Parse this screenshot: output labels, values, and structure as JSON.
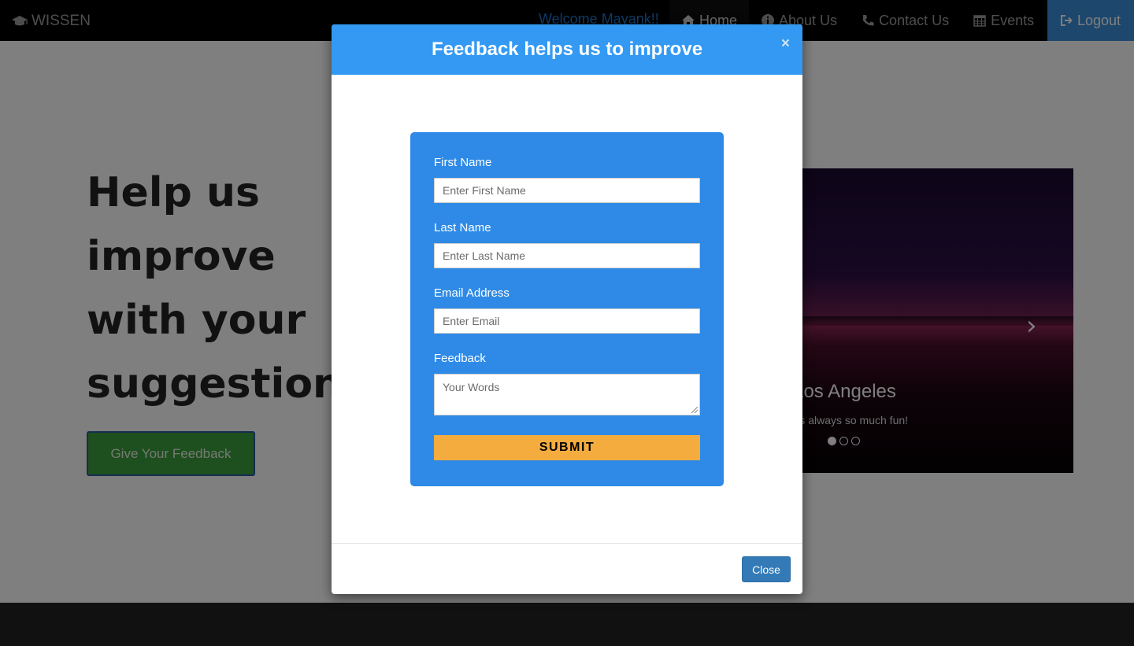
{
  "navbar": {
    "brand": "WISSEN",
    "welcome": "Welcome Mayank!!",
    "items": [
      {
        "label": "Home",
        "icon": "home-icon"
      },
      {
        "label": "About Us",
        "icon": "info-icon"
      },
      {
        "label": "Contact Us",
        "icon": "phone-icon"
      },
      {
        "label": "Events",
        "icon": "calendar-icon"
      },
      {
        "label": "Logout",
        "icon": "logout-icon"
      }
    ]
  },
  "hero": {
    "title": "Help us improve with your suggestions",
    "button": "Give Your Feedback"
  },
  "carousel": {
    "caption_title": "Los Angeles",
    "caption_text": "LA is always so much fun!",
    "active_slide": 1,
    "slide_count": 3
  },
  "modal": {
    "title": "Feedback helps us to improve",
    "close_x": "×",
    "fields": [
      {
        "label": "First Name",
        "placeholder": "Enter First Name"
      },
      {
        "label": "Last Name",
        "placeholder": "Enter Last Name"
      },
      {
        "label": "Email Address",
        "placeholder": "Enter Email"
      }
    ],
    "feedback_label": "Feedback",
    "feedback_placeholder": "Your Words",
    "submit": "SUBMIT",
    "close_button": "Close"
  },
  "colors": {
    "modal_header": "#3399f3",
    "form_box": "#2e8ae6",
    "submit": "#f5ac3f",
    "close_button": "#337ab7",
    "hero_button": "#3c9e3c"
  }
}
